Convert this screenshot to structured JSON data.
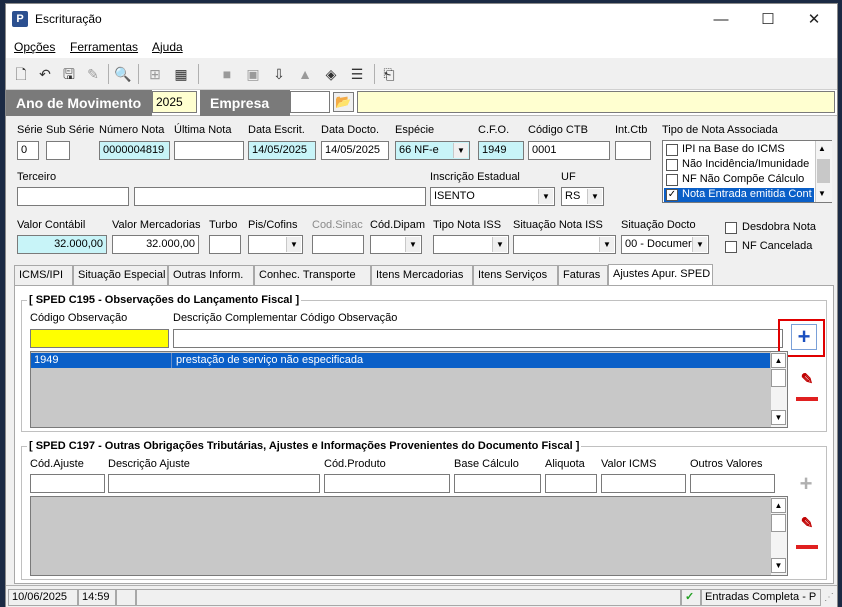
{
  "window": {
    "title": "Escrituração",
    "controls": [
      "—",
      "☐",
      "✕"
    ]
  },
  "menu": [
    "Opções",
    "Ferramentas",
    "Ajuda"
  ],
  "movimento": {
    "ano_label": "Ano de Movimento",
    "ano_value": "2025",
    "empresa_label": "Empresa",
    "empresa_value": ""
  },
  "header": {
    "serie_label": "Série",
    "serie_value": "0",
    "subserie_label": "Sub Série",
    "subserie_value": "",
    "numero_label": "Número Nota",
    "numero_value": "0000004819",
    "ultima_label": "Última Nota",
    "ultima_value": "",
    "escrit_label": "Data Escrit.",
    "escrit_value": "14/05/2025",
    "docto_label": "Data Docto.",
    "docto_value": "14/05/2025",
    "especie_label": "Espécie",
    "especie_value": "66  NF-e",
    "cfo_label": "C.F.O.",
    "cfo_value": "1949",
    "ctb_label": "Código CTB",
    "ctb_value": "0001",
    "intctb_label": "Int.Ctb",
    "intctb_value": "",
    "tiponota_label": "Tipo de Nota Associada",
    "tiponota_items": [
      {
        "label": "IPI na Base do ICMS",
        "checked": false,
        "selected": false
      },
      {
        "label": "Não Incidência/Imunidade",
        "checked": false,
        "selected": false
      },
      {
        "label": "NF Não Compõe Cálculo",
        "checked": false,
        "selected": false
      },
      {
        "label": "Nota Entrada emitida Cont",
        "checked": true,
        "selected": true
      }
    ],
    "terceiro_label": "Terceiro",
    "terceiro_code": "",
    "terceiro_name": "",
    "ie_label": "Inscrição Estadual",
    "ie_value": "ISENTO",
    "uf_label": "UF",
    "uf_value": "RS"
  },
  "values": {
    "contabil_label": "Valor Contábil",
    "contabil_value": "32.000,00",
    "mercadorias_label": "Valor Mercadorias",
    "mercadorias_value": "32.000,00",
    "turbo_label": "Turbo",
    "turbo_value": "",
    "piscofins_label": "Pis/Cofins",
    "piscofins_value": "",
    "codsinac_label": "Cod.Sinac",
    "codsinac_value": "",
    "coddipam_label": "Cód.Dipam",
    "coddipam_value": "",
    "tiponotaiss_label": "Tipo Nota ISS",
    "tiponotaiss_value": "",
    "situacaoiss_label": "Situação Nota ISS",
    "situacaoiss_value": "",
    "situacaodocto_label": "Situação Docto",
    "situacaodocto_value": "00 - Documer",
    "desdobra_label": "Desdobra Nota",
    "cancelada_label": "NF Cancelada"
  },
  "tabs": [
    "ICMS/IPI",
    "Situação Especial",
    "Outras Inform.",
    "Conhec. Transporte",
    "Itens Mercadorias",
    "Itens Serviços",
    "Faturas",
    "Ajustes Apur. SPED"
  ],
  "active_tab_index": 7,
  "c195": {
    "title": "[ SPED C195 - Observações do Lançamento Fiscal ]",
    "codigo_label": "Código Observação",
    "descricao_label": "Descrição Complementar Código Observação",
    "codigo_value": "",
    "descricao_value": "",
    "rows": [
      {
        "codigo": "1949",
        "descricao": "prestação de serviço não especificada"
      }
    ]
  },
  "c197": {
    "title": "[ SPED C197 - Outras Obrigações Tributárias, Ajustes e Informações Provenientes do Documento Fiscal ]",
    "cols": [
      "Cód.Ajuste",
      "Descrição Ajuste",
      "Cód.Produto",
      "Base Cálculo",
      "Aliquota",
      "Valor ICMS",
      "Outros Valores"
    ]
  },
  "status": {
    "date": "10/06/2025",
    "time": "14:59",
    "message": "Entradas Completa - P"
  },
  "colors": {
    "highlight": "#0a5fc8",
    "yellow": "#ffff00",
    "cyan": "#c8f4f8",
    "red_box": "#e00000",
    "plus_blue": "#1a4fc0",
    "minus_red": "#e02020"
  }
}
